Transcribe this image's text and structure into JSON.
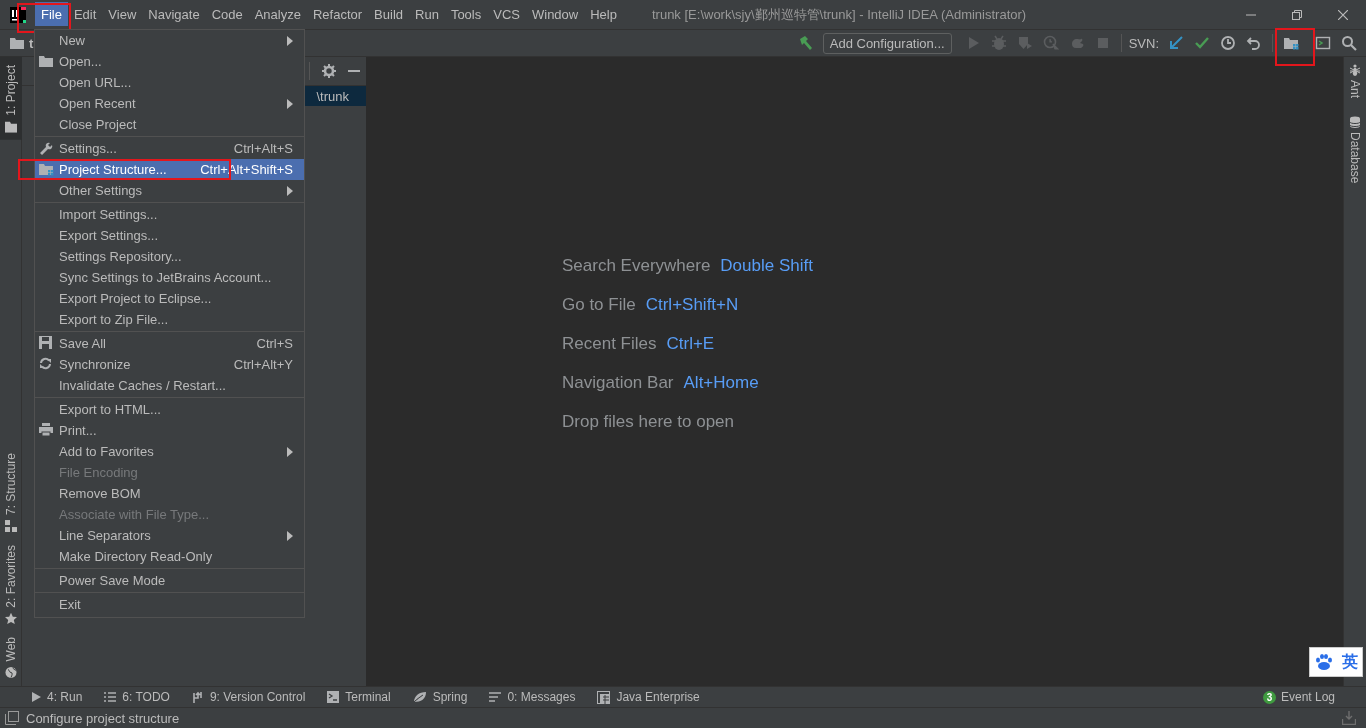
{
  "title_bar": {
    "menus": [
      {
        "label": "File",
        "selected": true,
        "highlighted": true
      },
      {
        "label": "Edit",
        "selected": false,
        "highlighted": false
      },
      {
        "label": "View",
        "selected": false,
        "highlighted": false
      },
      {
        "label": "Navigate",
        "selected": false,
        "highlighted": false
      },
      {
        "label": "Code",
        "selected": false,
        "highlighted": false
      },
      {
        "label": "Analyze",
        "selected": false,
        "highlighted": false
      },
      {
        "label": "Refactor",
        "selected": false,
        "highlighted": false
      },
      {
        "label": "Build",
        "selected": false,
        "highlighted": false
      },
      {
        "label": "Run",
        "selected": false,
        "highlighted": false
      },
      {
        "label": "Tools",
        "selected": false,
        "highlighted": false
      },
      {
        "label": "VCS",
        "selected": false,
        "highlighted": false
      },
      {
        "label": "Window",
        "selected": false,
        "highlighted": false
      },
      {
        "label": "Help",
        "selected": false,
        "highlighted": false
      }
    ],
    "title": "trunk [E:\\work\\sjy\\鄞州巡特管\\trunk] - IntelliJ IDEA (Administrator)"
  },
  "toolbar": {
    "project_crumb": "t",
    "run_config": "Add Configuration...",
    "vcs_label": "SVN:",
    "run_buttons": [
      {
        "kind": "build",
        "disabled": false
      },
      {
        "kind": "run",
        "disabled": true
      },
      {
        "kind": "debug",
        "disabled": true
      },
      {
        "kind": "coverage",
        "disabled": true
      },
      {
        "kind": "profile",
        "disabled": true
      },
      {
        "kind": "attach",
        "disabled": true
      },
      {
        "kind": "stop",
        "disabled": true
      }
    ],
    "vcs_buttons": [
      {
        "kind": "update",
        "highlighted": false
      },
      {
        "kind": "commit",
        "highlighted": false
      },
      {
        "kind": "history",
        "highlighted": false
      },
      {
        "kind": "revert",
        "highlighted": false
      },
      {
        "kind": "project-structure",
        "highlighted": true
      },
      {
        "kind": "terminal",
        "highlighted": false
      },
      {
        "kind": "search",
        "highlighted": false
      }
    ]
  },
  "left_stripe": {
    "top_tabs": [
      {
        "label": "1: Project",
        "selected": true
      }
    ],
    "bottom_tabs": [
      {
        "label": "7: Structure",
        "selected": false
      },
      {
        "label": "2: Favorites",
        "selected": false
      },
      {
        "label": "Web",
        "selected": false
      }
    ]
  },
  "project_panel": {
    "rows": [
      {
        "label": "\\trunk",
        "selected": true
      }
    ]
  },
  "editor": {
    "hints": [
      {
        "action": "Search Everywhere",
        "shortcut": "Double Shift"
      },
      {
        "action": "Go to File",
        "shortcut": "Ctrl+Shift+N"
      },
      {
        "action": "Recent Files",
        "shortcut": "Ctrl+E"
      },
      {
        "action": "Navigation Bar",
        "shortcut": "Alt+Home"
      },
      {
        "action": "Drop files here to open"
      }
    ]
  },
  "right_stripe": {
    "tabs": [
      {
        "label": "Ant",
        "selected": false
      },
      {
        "label": "Database",
        "selected": false
      }
    ]
  },
  "file_menu": {
    "items": [
      {
        "kind": "item",
        "label": "New",
        "submenu": true,
        "disabled": false,
        "selected": false,
        "highlighted": false
      },
      {
        "kind": "item",
        "label": "Open...",
        "disabled": false,
        "selected": false,
        "highlighted": false
      },
      {
        "kind": "item",
        "label": "Open URL...",
        "disabled": false,
        "selected": false,
        "highlighted": false
      },
      {
        "kind": "item",
        "label": "Open Recent",
        "submenu": true,
        "disabled": false,
        "selected": false,
        "highlighted": false
      },
      {
        "kind": "item",
        "label": "Close Project",
        "disabled": false,
        "selected": false,
        "highlighted": false
      },
      {
        "kind": "separator"
      },
      {
        "kind": "item",
        "label": "Settings...",
        "shortcut": "Ctrl+Alt+S",
        "disabled": false,
        "selected": false,
        "highlighted": false
      },
      {
        "kind": "item",
        "label": "Project Structure...",
        "shortcut": "Ctrl+Alt+Shift+S",
        "disabled": false,
        "selected": true,
        "highlighted": true
      },
      {
        "kind": "item",
        "label": "Other Settings",
        "submenu": true,
        "disabled": false,
        "selected": false,
        "highlighted": false
      },
      {
        "kind": "separator"
      },
      {
        "kind": "item",
        "label": "Import Settings...",
        "disabled": false,
        "selected": false,
        "highlighted": false
      },
      {
        "kind": "item",
        "label": "Export Settings...",
        "disabled": false,
        "selected": false,
        "highlighted": false
      },
      {
        "kind": "item",
        "label": "Settings Repository...",
        "disabled": false,
        "selected": false,
        "highlighted": false
      },
      {
        "kind": "item",
        "label": "Sync Settings to JetBrains Account...",
        "disabled": false,
        "selected": false,
        "highlighted": false
      },
      {
        "kind": "item",
        "label": "Export Project to Eclipse...",
        "disabled": false,
        "selected": false,
        "highlighted": false
      },
      {
        "kind": "item",
        "label": "Export to Zip File...",
        "disabled": false,
        "selected": false,
        "highlighted": false
      },
      {
        "kind": "separator"
      },
      {
        "kind": "item",
        "label": "Save All",
        "shortcut": "Ctrl+S",
        "disabled": false,
        "selected": false,
        "highlighted": false
      },
      {
        "kind": "item",
        "label": "Synchronize",
        "shortcut": "Ctrl+Alt+Y",
        "disabled": false,
        "selected": false,
        "highlighted": false
      },
      {
        "kind": "item",
        "label": "Invalidate Caches / Restart...",
        "disabled": false,
        "selected": false,
        "highlighted": false
      },
      {
        "kind": "separator"
      },
      {
        "kind": "item",
        "label": "Export to HTML...",
        "disabled": false,
        "selected": false,
        "highlighted": false
      },
      {
        "kind": "item",
        "label": "Print...",
        "disabled": false,
        "selected": false,
        "highlighted": false
      },
      {
        "kind": "item",
        "label": "Add to Favorites",
        "submenu": true,
        "disabled": false,
        "selected": false,
        "highlighted": false
      },
      {
        "kind": "item",
        "label": "File Encoding",
        "disabled": true,
        "selected": false,
        "highlighted": false
      },
      {
        "kind": "item",
        "label": "Remove BOM",
        "disabled": false,
        "selected": false,
        "highlighted": false
      },
      {
        "kind": "item",
        "label": "Associate with File Type...",
        "disabled": true,
        "selected": false,
        "highlighted": false
      },
      {
        "kind": "item",
        "label": "Line Separators",
        "submenu": true,
        "disabled": false,
        "selected": false,
        "highlighted": false
      },
      {
        "kind": "item",
        "label": "Make Directory Read-Only",
        "disabled": false,
        "selected": false,
        "highlighted": false
      },
      {
        "kind": "separator"
      },
      {
        "kind": "item",
        "label": "Power Save Mode",
        "disabled": false,
        "selected": false,
        "highlighted": false
      },
      {
        "kind": "separator"
      },
      {
        "kind": "item",
        "label": "Exit",
        "disabled": false,
        "selected": false,
        "highlighted": false
      }
    ]
  },
  "tool_windows": [
    {
      "label": "4: Run"
    },
    {
      "label": "6: TODO"
    },
    {
      "label": "9: Version Control"
    },
    {
      "label": "Terminal"
    },
    {
      "label": "Spring"
    },
    {
      "label": "0: Messages"
    },
    {
      "label": "Java Enterprise"
    }
  ],
  "event_log": {
    "count": "3",
    "label": "Event Log"
  },
  "status_bar": {
    "text": "Configure project structure"
  },
  "ime_indicator": {
    "mode": "英"
  }
}
